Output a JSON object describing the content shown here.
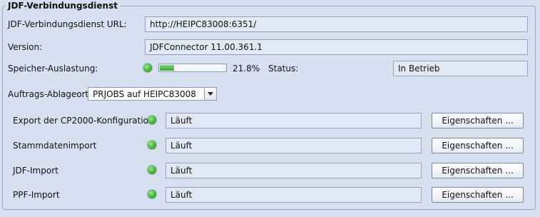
{
  "group": {
    "title": "JDF-Verbindungsdienst"
  },
  "url": {
    "label": "JDF-Verbindungsdienst URL:",
    "value": "http://HEIPC83008:6351/"
  },
  "version": {
    "label": "Version:",
    "value": "JDFConnector 11.00.361.1"
  },
  "memory": {
    "label": "Speicher-Auslastung:",
    "percent_text": "21.8%",
    "fraction": 0.218,
    "status_label": "Status:",
    "status_value": "In Betrieb"
  },
  "storage": {
    "label": "Auftrags-Ablageort:",
    "selected": "PRJOBS auf HEIPC83008"
  },
  "services": [
    {
      "label": "Export der CP2000-Konfiguration",
      "status": "Läuft",
      "button": "Eigenschaften ..."
    },
    {
      "label": "Stammdatenimport",
      "status": "Läuft",
      "button": "Eigenschaften ..."
    },
    {
      "label": "JDF-Import",
      "status": "Läuft",
      "button": "Eigenschaften ..."
    },
    {
      "label": "PPF-Import",
      "status": "Läuft",
      "button": "Eigenschaften ..."
    }
  ],
  "colors": {
    "background": "#d6e0f0",
    "led_green": "#43b33a",
    "progress_green": "#3fa63b"
  },
  "icons": {
    "status_led": "green-status-led-icon",
    "dropdown": "chevron-down-icon"
  }
}
